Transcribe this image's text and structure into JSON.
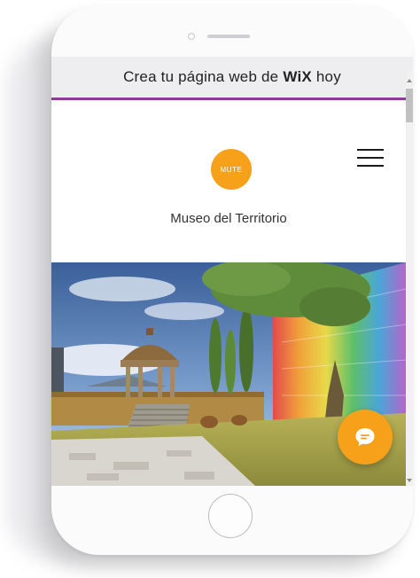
{
  "banner": {
    "text_before": "Crea tu página web de",
    "brand": "WiX",
    "text_after": "hoy"
  },
  "site": {
    "logo_text": "MUTE",
    "title": "Museo del Territorio"
  },
  "icons": {
    "menu": "hamburger-menu-icon",
    "chat": "chat-bubble-icon"
  },
  "colors": {
    "accent": "#f7a11a",
    "banner_border": "#8b3d98",
    "banner_bg": "#eeeef0"
  }
}
